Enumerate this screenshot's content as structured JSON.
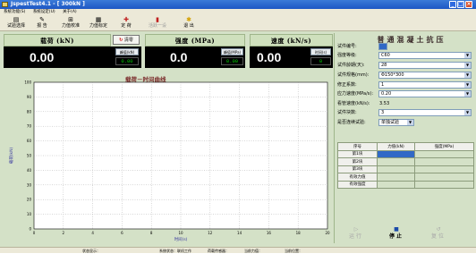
{
  "window": {
    "title": "JspestTest4.1 - [ 300kN ]"
  },
  "menu": [
    "系统功能(S)",
    "系统设定(U)",
    "关于(A)"
  ],
  "toolbar": [
    {
      "label": "试验选择",
      "icon": "▤",
      "disabled": false
    },
    {
      "label": "报 告",
      "icon": "✎",
      "disabled": false
    },
    {
      "label": "力值校准",
      "icon": "⊞",
      "disabled": false
    },
    {
      "label": "力值标定",
      "icon": "▦",
      "disabled": false
    },
    {
      "label": "定 荷",
      "icon": "✚",
      "disabled": false
    },
    {
      "label": "活跃一设",
      "icon": "▮",
      "disabled": true
    },
    {
      "label": "退 出",
      "icon": "✱",
      "disabled": false
    }
  ],
  "gauges": {
    "load": {
      "title": "载荷 (kN)",
      "value": "0.00",
      "peak_label": "峰值(kN)",
      "peak_value": "0.00",
      "clear_label": "清零"
    },
    "strength": {
      "title": "强度 (MPa)",
      "value": "0.0",
      "peak_label": "峰值(MPa)",
      "peak_value": "0.00"
    },
    "speed": {
      "title": "速度 (kN/s)",
      "value": "0.00",
      "time_label": "时间(s)",
      "time_value": "0"
    }
  },
  "chart_data": {
    "type": "line",
    "title": "载荷－时间曲线",
    "xlabel": "时间(s)",
    "ylabel": "载荷(kN)",
    "xlim": [
      0,
      20
    ],
    "ylim": [
      0,
      100
    ],
    "xticks": [
      0,
      2,
      4,
      6,
      8,
      10,
      12,
      14,
      16,
      18,
      20
    ],
    "yticks": [
      0,
      10,
      20,
      30,
      40,
      50,
      60,
      70,
      80,
      90,
      100
    ],
    "grid": true,
    "series": [
      {
        "values": []
      }
    ]
  },
  "panel": {
    "title": "普通混凝土抗压",
    "fields": [
      {
        "label": "试件编号:",
        "value": "",
        "kind": "selected"
      },
      {
        "label": "强度等级:",
        "value": "C60",
        "kind": "dropdown"
      },
      {
        "label": "试件龄期(天):",
        "value": "28",
        "kind": "dropdown"
      },
      {
        "label": "试件规格(mm):",
        "value": "Φ150*300",
        "kind": "dropdown"
      },
      {
        "label": "修正系数:",
        "value": "1",
        "kind": "dropdown"
      },
      {
        "label": "应力速度(MPa/s):",
        "value": "0.20",
        "kind": "dropdown"
      },
      {
        "label": "看管速度(kN/s):",
        "value": "3.53",
        "kind": "static"
      },
      {
        "label": "试件块数:",
        "value": "3",
        "kind": "dropdown"
      },
      {
        "label": "是否连续试验:",
        "value": "单独试验",
        "kind": "small"
      }
    ],
    "table": {
      "headers": [
        "序号",
        "力值(kN)",
        "强度(MPa)"
      ],
      "rows": [
        "第1块",
        "第2块",
        "第3块",
        "有效力值",
        "有效强度"
      ]
    },
    "buttons": [
      {
        "label": "运行",
        "icon": "▷",
        "disabled": true
      },
      {
        "label": "停止",
        "icon": "■",
        "disabled": false
      },
      {
        "label": "复位",
        "icon": "↺",
        "disabled": true
      }
    ]
  },
  "status": {
    "state": "状态显示：",
    "work": "系统状态：联机工作",
    "sensor": "荷载传感器：",
    "current_force": "当前力值：",
    "current_pos": "当前位置："
  },
  "colors": {
    "accent": "#3169c6",
    "panel_bg": "#d4e1c7",
    "display_bg": "#000000",
    "peak_text": "#00d000",
    "chart_title": "#7a2a2a"
  }
}
